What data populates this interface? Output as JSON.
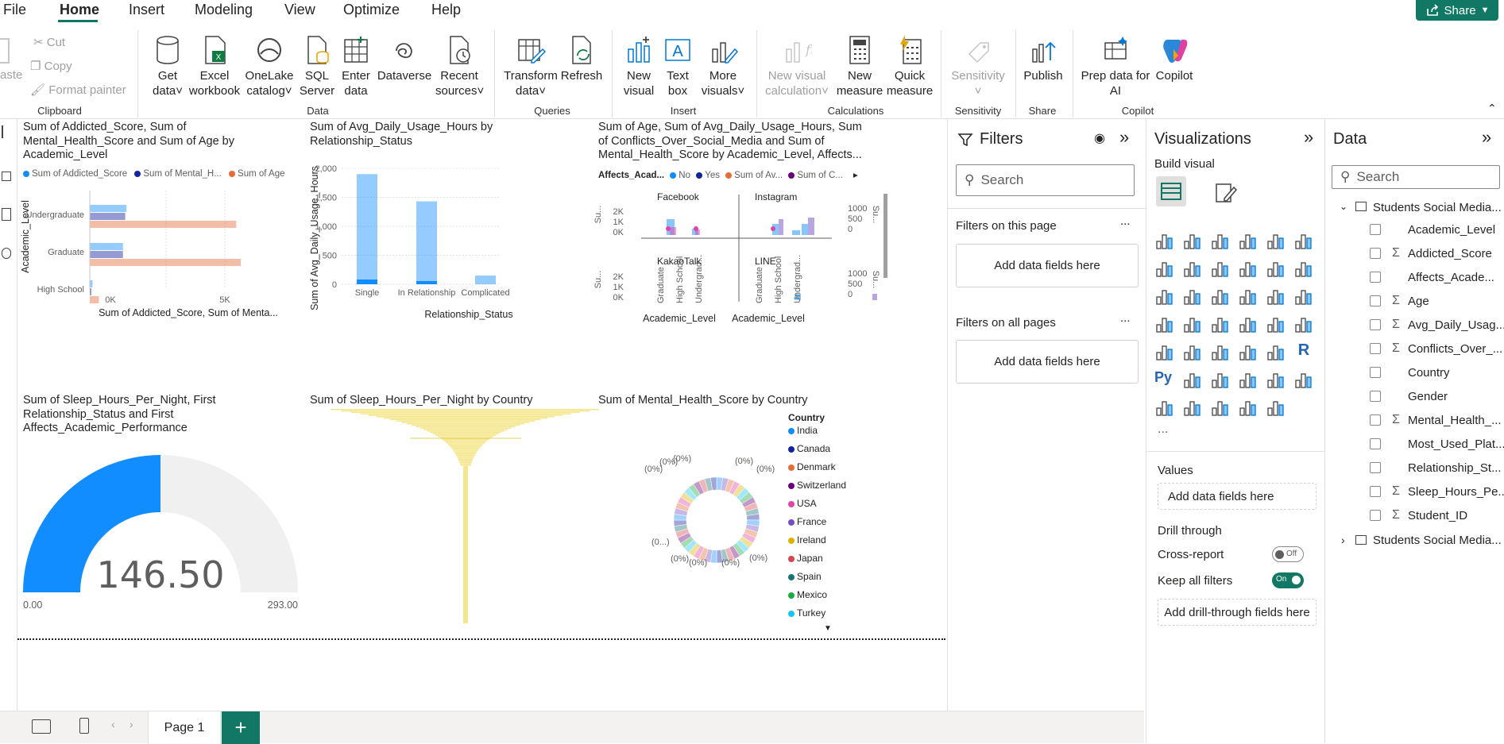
{
  "menu": {
    "file": "File",
    "home": "Home",
    "insert": "Insert",
    "modeling": "Modeling",
    "view": "View",
    "optimize": "Optimize",
    "help": "Help",
    "share": "Share"
  },
  "ribbon": {
    "paste": "aste",
    "cut": "Cut",
    "copy": "Copy",
    "format_painter": "Format painter",
    "get_data": [
      "Get",
      "data"
    ],
    "excel": [
      "Excel",
      "workbook"
    ],
    "onelake": [
      "OneLake",
      "catalog"
    ],
    "sql": [
      "SQL",
      "Server"
    ],
    "enter": [
      "Enter",
      "data"
    ],
    "dataverse": "Dataverse",
    "recent": [
      "Recent",
      "sources"
    ],
    "transform": [
      "Transform",
      "data"
    ],
    "refresh": "Refresh",
    "new_visual": [
      "New",
      "visual"
    ],
    "text_box": [
      "Text",
      "box"
    ],
    "more_visuals": [
      "More",
      "visuals"
    ],
    "new_visual_calc": [
      "New visual",
      "calculation"
    ],
    "new_measure": [
      "New",
      "measure"
    ],
    "quick_measure": [
      "Quick",
      "measure"
    ],
    "sensitivity": "Sensitivity",
    "publish": "Publish",
    "copilot": [
      "Prep data for",
      "AI"
    ],
    "copilot2": "Copilot",
    "groups": {
      "clipboard": "Clipboard",
      "data": "Data",
      "queries": "Queries",
      "insert": "Insert",
      "calculations": "Calculations",
      "sensitivity": "Sensitivity",
      "share": "Share",
      "copilot": "Copilot"
    }
  },
  "visuals": {
    "v1": {
      "title": [
        "Sum of Addicted_Score, Sum of",
        "Mental_Health_Score and Sum of Age by",
        "Academic_Level"
      ],
      "legend": [
        "Sum of Addicted_Score",
        "Sum of Mental_H...",
        "Sum of Age"
      ],
      "ylabel": "Academic_Level",
      "xlabel": "Sum of Addicted_Score, Sum of Menta...",
      "xticks": [
        "0K",
        "5K"
      ]
    },
    "v2": {
      "title": [
        "Sum of Avg_Daily_Usage_Hours by",
        "Relationship_Status"
      ],
      "ylabel": "Sum of Avg_Daily_Usage_Hours",
      "xlabel": "Relationship_Status",
      "yticks": [
        "2,000",
        "1,500",
        "1,000",
        "500",
        "0"
      ]
    },
    "v3": {
      "title": [
        "Sum of Age, Sum of Avg_Daily_Usage_Hours, Sum",
        "of Conflicts_Over_Social_Media and Sum of",
        "Mental_Health_Score by Academic_Level, Affects..."
      ],
      "legend_title": "Affects_Acad...",
      "legend": [
        "No",
        "Yes",
        "Sum of Av...",
        "Sum of C..."
      ],
      "panels": [
        "Facebook",
        "Instagram",
        "KakaoTalk",
        "LINE"
      ],
      "lticks": [
        "2K",
        "1K",
        "0K"
      ],
      "rticks": [
        "1000",
        "500",
        "0"
      ],
      "ylab": "Su...",
      "xcats": [
        "Graduate",
        "High School",
        "Undergrad..."
      ],
      "xlabel": "Academic_Level"
    },
    "v4": {
      "title": [
        "Sum of Sleep_Hours_Per_Night, First",
        "Relationship_Status and First",
        "Affects_Academic_Performance"
      ],
      "value": "146.50",
      "min": "0.00",
      "max": "293.00"
    },
    "v5": {
      "title": [
        "Sum of Sleep_Hours_Per_Night by Country"
      ]
    },
    "v6": {
      "title": [
        "Sum of Mental_Health_Score by Country"
      ],
      "legend_title": "Country",
      "pct": "(0%)",
      "pct_short": "(0...)"
    }
  },
  "chart_data": [
    {
      "type": "bar",
      "title": "Sum of Addicted_Score, Sum of Mental_Health_Score and Sum of Age by Academic_Level",
      "categories": [
        "Undergraduate",
        "Graduate",
        "High School"
      ],
      "series": [
        {
          "name": "Sum of Addicted_Score",
          "values": [
            1600,
            1450,
            120
          ]
        },
        {
          "name": "Sum of Mental_H...",
          "values": [
            1550,
            1450,
            70
          ]
        },
        {
          "name": "Sum of Age",
          "values": [
            6400,
            6600,
            400
          ]
        }
      ],
      "xlabel": "Sum of Addicted_Score, Sum of Menta...",
      "ylabel": "Academic_Level"
    },
    {
      "type": "bar",
      "title": "Sum of Avg_Daily_Usage_Hours by Relationship_Status",
      "categories": [
        "Single",
        "In Relationship",
        "Complicated"
      ],
      "values": [
        1900,
        1430,
        150
      ],
      "ylim": [
        0,
        2000
      ],
      "xlabel": "Relationship_Status",
      "ylabel": "Sum of Avg_Daily_Usage_Hours"
    },
    {
      "type": "bar",
      "title": "Sum of Age, Sum of Avg_Daily_Usage_Hours, Sum of Conflicts_Over_Social_Media and Sum of Mental_Health_Score by Academic_Level, Affects...",
      "categories": [
        "Graduate",
        "High School",
        "Undergrad..."
      ],
      "panels": [
        "Facebook",
        "Instagram",
        "KakaoTalk",
        "LINE"
      ]
    },
    {
      "type": "gauge",
      "value": 146.5,
      "min": 0,
      "max": 293
    },
    {
      "type": "bar",
      "title": "Sum of Sleep_Hours_Per_Night by Country"
    },
    {
      "type": "pie",
      "title": "Sum of Mental_Health_Score by Country",
      "categories": [
        "India",
        "Canada",
        "Denmark",
        "Switzerland",
        "USA",
        "France",
        "Ireland",
        "Japan",
        "Spain",
        "Mexico",
        "Turkey"
      ]
    }
  ],
  "countries": [
    {
      "name": "India",
      "color": "#118dff"
    },
    {
      "name": "Canada",
      "color": "#12239e"
    },
    {
      "name": "Denmark",
      "color": "#e66c37"
    },
    {
      "name": "Switzerland",
      "color": "#6b007b"
    },
    {
      "name": "USA",
      "color": "#e044a7"
    },
    {
      "name": "France",
      "color": "#744ec2"
    },
    {
      "name": "Ireland",
      "color": "#d9b300"
    },
    {
      "name": "Japan",
      "color": "#d64550"
    },
    {
      "name": "Spain",
      "color": "#197278"
    },
    {
      "name": "Mexico",
      "color": "#1aab40"
    },
    {
      "name": "Turkey",
      "color": "#15c6f4"
    }
  ],
  "filters": {
    "title": "Filters",
    "search": "Search",
    "on_page": "Filters on this page",
    "all_pages": "Filters on all pages",
    "add": "Add data fields here",
    "more": "..."
  },
  "viz": {
    "title": "Visualizations",
    "build": "Build visual",
    "values": "Values",
    "add_values": "Add data fields here",
    "drill": "Drill through",
    "cross": "Cross-report",
    "cross_state": "Off",
    "keep": "Keep all filters",
    "keep_state": "On",
    "add_drill": "Add drill-through fields here",
    "more": "..."
  },
  "data": {
    "title": "Data",
    "search": "Search",
    "table1": "Students Social Media...",
    "table2": "Students Social Media...",
    "fields": [
      {
        "name": "Academic_Level",
        "sigma": false
      },
      {
        "name": "Addicted_Score",
        "sigma": true
      },
      {
        "name": "Affects_Acade...",
        "sigma": false
      },
      {
        "name": "Age",
        "sigma": true
      },
      {
        "name": "Avg_Daily_Usag...",
        "sigma": true
      },
      {
        "name": "Conflicts_Over_...",
        "sigma": true
      },
      {
        "name": "Country",
        "sigma": false
      },
      {
        "name": "Gender",
        "sigma": false
      },
      {
        "name": "Mental_Health_...",
        "sigma": true
      },
      {
        "name": "Most_Used_Plat...",
        "sigma": false
      },
      {
        "name": "Relationship_St...",
        "sigma": false
      },
      {
        "name": "Sleep_Hours_Pe...",
        "sigma": true
      },
      {
        "name": "Student_ID",
        "sigma": true
      }
    ]
  },
  "pages": {
    "tab": "Page 1",
    "add": "+"
  },
  "colors": {
    "accent": "#118dff",
    "dark_blue": "#12239e",
    "orange": "#e66c37",
    "green": "#117865"
  }
}
